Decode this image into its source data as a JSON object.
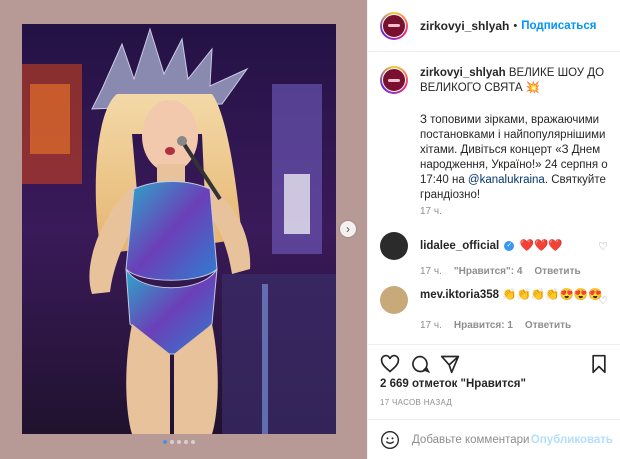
{
  "post": {
    "username": "zirkovyi_shlyah",
    "separator": "•",
    "follow_label": "Подписаться",
    "caption_title": "ВЕЛИКЕ ШОУ ДО ВЕЛИКОГО СВЯТА 💥",
    "caption_body_1": "З топовими зірками, вражаючими постановками і найпопулярнішими хітами. Дивіться концерт «З Днем народження, Україно!» 24 серпня о 17:40 на ",
    "caption_mention": "@kanalukraina",
    "caption_body_2": ". Святкуйте грандіозно!",
    "caption_time": "17 ч.",
    "likes": "2 669 отметок \"Нравится\"",
    "time_ago": "17 ЧАСОВ НАЗАД",
    "carousel": {
      "slides": 5,
      "active": 1
    }
  },
  "comments": [
    {
      "name": "lidalee_official",
      "verified": true,
      "text": "❤️❤️❤️",
      "time": "17 ч.",
      "likes": "\"Нравится\": 4",
      "reply": "Ответить"
    },
    {
      "name": "mev.iktoria358",
      "verified": false,
      "text": "👏👏👏👏😍😍😍",
      "time": "17 ч.",
      "likes": "Нравится: 1",
      "reply": "Ответить"
    }
  ],
  "comment_box": {
    "placeholder": "Добавьте комментарий...",
    "publish": "Опубликовать"
  },
  "colors": {
    "accent": "#0095f6",
    "panel_bg": "#b79a95"
  },
  "icons": [
    "heart-icon",
    "comment-icon",
    "share-icon",
    "bookmark-icon",
    "emoji-icon",
    "chevron-right-icon"
  ]
}
